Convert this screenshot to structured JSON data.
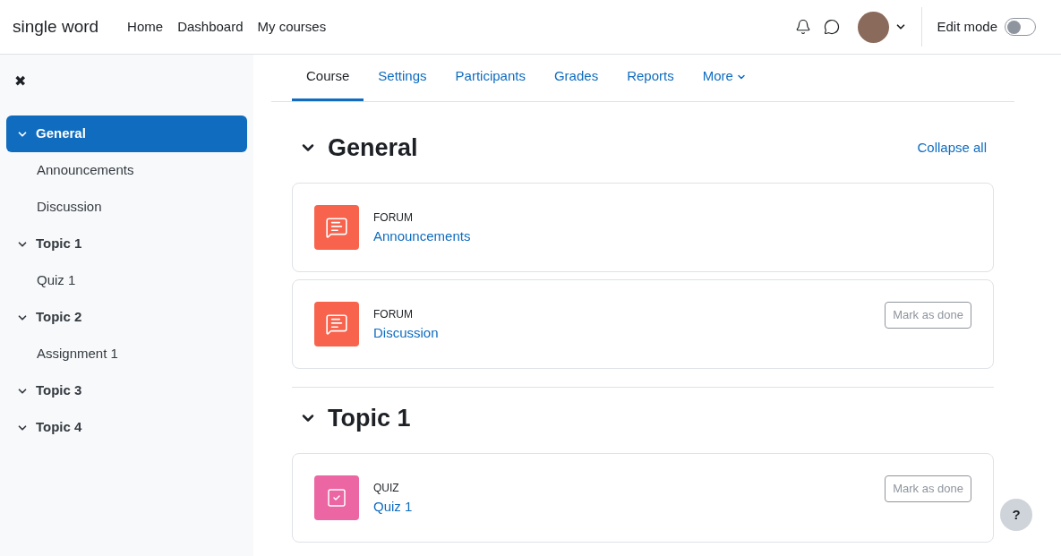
{
  "navbar": {
    "brand": "single word",
    "links": [
      {
        "label": "Home"
      },
      {
        "label": "Dashboard"
      },
      {
        "label": "My courses"
      }
    ],
    "edit_mode": {
      "label": "Edit mode",
      "on": false
    }
  },
  "sidebar": {
    "close": "✖",
    "sections": [
      {
        "label": "General",
        "expanded": true,
        "selected": true,
        "children": [
          {
            "label": "Announcements"
          },
          {
            "label": "Discussion"
          }
        ]
      },
      {
        "label": "Topic 1",
        "expanded": true,
        "selected": false,
        "children": [
          {
            "label": "Quiz 1"
          }
        ]
      },
      {
        "label": "Topic 2",
        "expanded": true,
        "selected": false,
        "children": [
          {
            "label": "Assignment 1"
          }
        ]
      },
      {
        "label": "Topic 3",
        "expanded": true,
        "selected": false
      },
      {
        "label": "Topic 4",
        "expanded": true,
        "selected": false
      }
    ]
  },
  "tabs": [
    {
      "label": "Course",
      "selected": true
    },
    {
      "label": "Settings",
      "selected": false
    },
    {
      "label": "Participants",
      "selected": false
    },
    {
      "label": "Grades",
      "selected": false
    },
    {
      "label": "Reports",
      "selected": false
    },
    {
      "label": "More",
      "selected": false,
      "dropdown": true
    }
  ],
  "sections": [
    {
      "title": "General",
      "expanded": true,
      "action": "Collapse all",
      "activities": [
        {
          "kind": "forum",
          "type": "FORUM",
          "name": "Announcements"
        },
        {
          "kind": "forum",
          "type": "FORUM",
          "name": "Discussion",
          "button": "Mark as done"
        }
      ]
    },
    {
      "title": "Topic 1",
      "expanded": true,
      "activities": [
        {
          "kind": "quiz",
          "type": "QUIZ",
          "name": "Quiz 1",
          "button": "Mark as done"
        }
      ]
    }
  ],
  "help": "?"
}
